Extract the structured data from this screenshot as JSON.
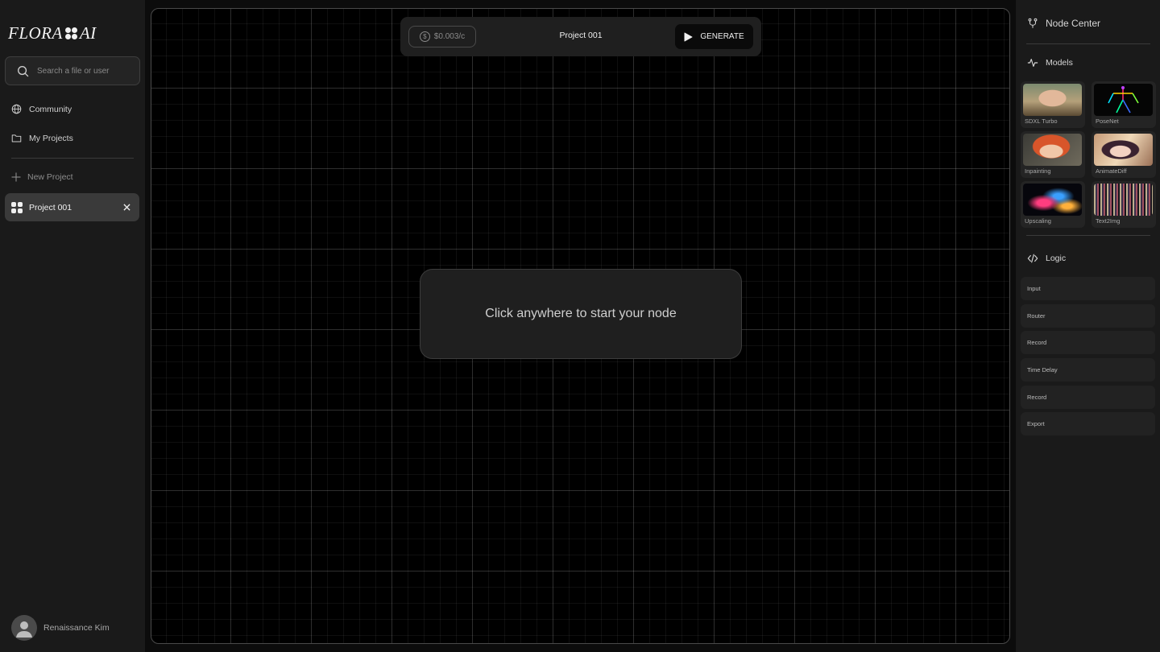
{
  "brand": {
    "left": "FLORA",
    "right": "AI"
  },
  "search": {
    "placeholder": "Search a file or user"
  },
  "nav": {
    "community": "Community",
    "my_projects": "My Projects"
  },
  "projects": {
    "new_label": "New Project",
    "active": "Project 001"
  },
  "user": {
    "name": "Renaissance Kim"
  },
  "topbar": {
    "price": "$0.003/c",
    "title": "Project 001",
    "generate_label": "GENERATE"
  },
  "canvas": {
    "hint": "Click anywhere to start your node"
  },
  "right_panel": {
    "node_center": "Node Center",
    "models_title": "Models",
    "models": [
      {
        "label": "SDXL Turbo"
      },
      {
        "label": "PoseNet"
      },
      {
        "label": "Inpainting"
      },
      {
        "label": "AnimateDiff"
      },
      {
        "label": "Upscaling"
      },
      {
        "label": "Text2Img"
      }
    ],
    "logic_title": "Logic",
    "logic_items": [
      "Input",
      "Router",
      "Record",
      "Time Delay",
      "Record",
      "Export"
    ]
  },
  "colors": {
    "background": "#0c0c0c",
    "panel": "#1a1a1a",
    "active_item": "#3a3a3a",
    "text": "#d6d6d6"
  }
}
